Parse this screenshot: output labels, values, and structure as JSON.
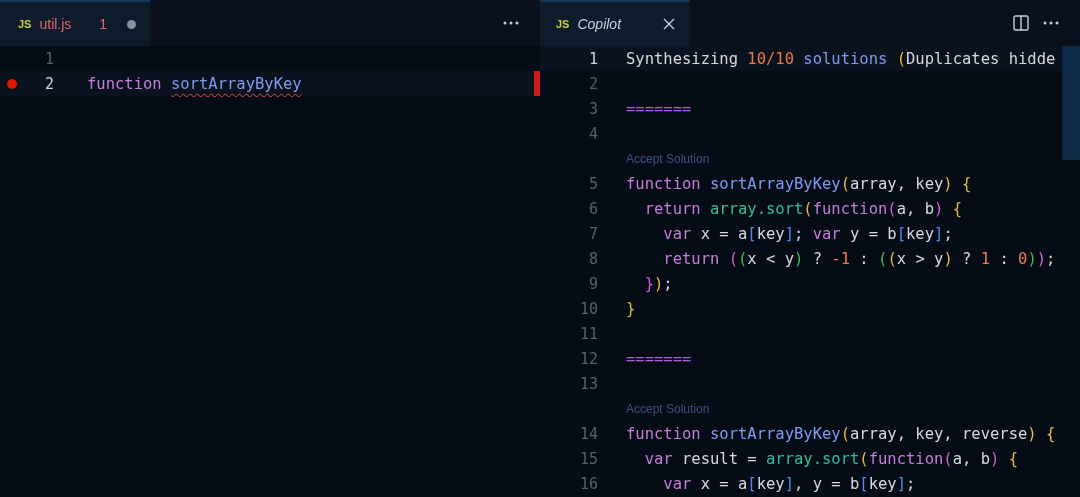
{
  "groups": [
    {
      "tab": {
        "icon": "JS",
        "label": "util.js",
        "badge": "1",
        "dirty": true,
        "error": true,
        "preview": false,
        "closable": false,
        "selected": true
      },
      "actions": [
        {
          "kind": "more"
        }
      ],
      "lines": [
        {
          "kind": "code",
          "number": "1",
          "current": false,
          "breakpoint": false
        },
        {
          "kind": "code",
          "number": "2",
          "current": true,
          "breakpoint": true,
          "error_mark": true,
          "tokens": [
            {
              "t": "function ",
              "kind": "keyword"
            },
            {
              "t": "sortArrayByKey",
              "kind": "function",
              "squiggle": true
            }
          ]
        }
      ]
    },
    {
      "tab": {
        "icon": "JS",
        "label": "Copilot",
        "dirty": false,
        "error": false,
        "preview": true,
        "closable": true,
        "selected": true
      },
      "actions": [
        {
          "kind": "split"
        },
        {
          "kind": "more"
        }
      ],
      "lines": [
        {
          "kind": "code",
          "number": "1",
          "current": true,
          "tokens": [
            {
              "t": "Synthesizing ",
              "kind": "plain"
            },
            {
              "t": "10/10",
              "kind": "number"
            },
            {
              "t": " solutions ",
              "kind": "function"
            },
            {
              "t": "(",
              "kind": "bracket1"
            },
            {
              "t": "Duplicates hidde",
              "kind": "plain"
            }
          ]
        },
        {
          "kind": "code",
          "number": "2",
          "current": false
        },
        {
          "kind": "code",
          "number": "3",
          "current": false,
          "tokens": [
            {
              "t": "=======",
              "kind": "separator"
            }
          ]
        },
        {
          "kind": "code",
          "number": "4",
          "current": false
        },
        {
          "kind": "codelens",
          "label": "Accept Solution"
        },
        {
          "kind": "code",
          "number": "5",
          "current": false,
          "tokens": [
            {
              "t": "function ",
              "kind": "keyword"
            },
            {
              "t": "sortArrayByKey",
              "kind": "function"
            },
            {
              "t": "(",
              "kind": "bracket1"
            },
            {
              "t": "array, key",
              "kind": "plain"
            },
            {
              "t": ") {",
              "kind": "bracket1"
            }
          ]
        },
        {
          "kind": "code",
          "number": "6",
          "current": false,
          "tokens": [
            {
              "t": "  return ",
              "kind": "keyword"
            },
            {
              "t": "array.sort",
              "kind": "variable"
            },
            {
              "t": "(",
              "kind": "bracket1"
            },
            {
              "t": "function",
              "kind": "keyword"
            },
            {
              "t": "(",
              "kind": "bracket2"
            },
            {
              "t": "a, b",
              "kind": "plain"
            },
            {
              "t": ")",
              "kind": "bracket2"
            },
            {
              "t": " {",
              "kind": "bracket1"
            }
          ]
        },
        {
          "kind": "code",
          "number": "7",
          "current": false,
          "tokens": [
            {
              "t": "    var ",
              "kind": "keyword"
            },
            {
              "t": "x = a",
              "kind": "plain"
            },
            {
              "t": "[",
              "kind": "bracket3"
            },
            {
              "t": "key",
              "kind": "plain"
            },
            {
              "t": "]",
              "kind": "bracket3"
            },
            {
              "t": "; ",
              "kind": "plain"
            },
            {
              "t": "var ",
              "kind": "keyword"
            },
            {
              "t": "y = b",
              "kind": "plain"
            },
            {
              "t": "[",
              "kind": "bracket3"
            },
            {
              "t": "key",
              "kind": "plain"
            },
            {
              "t": "]",
              "kind": "bracket3"
            },
            {
              "t": ";",
              "kind": "plain"
            }
          ]
        },
        {
          "kind": "code",
          "number": "8",
          "current": false,
          "tokens": [
            {
              "t": "    return ",
              "kind": "keyword"
            },
            {
              "t": "(",
              "kind": "bracket2"
            },
            {
              "t": "(",
              "kind": "bracket4"
            },
            {
              "t": "x < y",
              "kind": "plain"
            },
            {
              "t": ")",
              "kind": "bracket4"
            },
            {
              "t": " ? ",
              "kind": "plain"
            },
            {
              "t": "-1",
              "kind": "number"
            },
            {
              "t": " : ",
              "kind": "plain"
            },
            {
              "t": "(",
              "kind": "bracket4"
            },
            {
              "t": "(",
              "kind": "bracket1"
            },
            {
              "t": "x > y",
              "kind": "plain"
            },
            {
              "t": ")",
              "kind": "bracket1"
            },
            {
              "t": " ? ",
              "kind": "plain"
            },
            {
              "t": "1",
              "kind": "number"
            },
            {
              "t": " : ",
              "kind": "plain"
            },
            {
              "t": "0",
              "kind": "number"
            },
            {
              "t": ")",
              "kind": "bracket4"
            },
            {
              "t": ")",
              "kind": "bracket2"
            },
            {
              "t": ";",
              "kind": "plain"
            }
          ]
        },
        {
          "kind": "code",
          "number": "9",
          "current": false,
          "tokens": [
            {
              "t": "  }",
              "kind": "bracket2"
            },
            {
              "t": ")",
              "kind": "bracket1"
            },
            {
              "t": ";",
              "kind": "plain"
            }
          ]
        },
        {
          "kind": "code",
          "number": "10",
          "current": false,
          "tokens": [
            {
              "t": "}",
              "kind": "bracket1"
            }
          ]
        },
        {
          "kind": "code",
          "number": "11",
          "current": false
        },
        {
          "kind": "code",
          "number": "12",
          "current": false,
          "tokens": [
            {
              "t": "=======",
              "kind": "separator"
            }
          ]
        },
        {
          "kind": "code",
          "number": "13",
          "current": false
        },
        {
          "kind": "codelens",
          "label": "Accept Solution"
        },
        {
          "kind": "code",
          "number": "14",
          "current": false,
          "tokens": [
            {
              "t": "function ",
              "kind": "keyword"
            },
            {
              "t": "sortArrayByKey",
              "kind": "function"
            },
            {
              "t": "(",
              "kind": "bracket1"
            },
            {
              "t": "array, key, reverse",
              "kind": "plain"
            },
            {
              "t": ") {",
              "kind": "bracket1"
            }
          ]
        },
        {
          "kind": "code",
          "number": "15",
          "current": false,
          "tokens": [
            {
              "t": "  var ",
              "kind": "keyword"
            },
            {
              "t": "result = ",
              "kind": "plain"
            },
            {
              "t": "array.sort",
              "kind": "variable"
            },
            {
              "t": "(",
              "kind": "bracket1"
            },
            {
              "t": "function",
              "kind": "keyword"
            },
            {
              "t": "(",
              "kind": "bracket2"
            },
            {
              "t": "a, b",
              "kind": "plain"
            },
            {
              "t": ")",
              "kind": "bracket2"
            },
            {
              "t": " {",
              "kind": "bracket1"
            }
          ]
        },
        {
          "kind": "code",
          "number": "16",
          "current": false,
          "tokens": [
            {
              "t": "    var ",
              "kind": "keyword"
            },
            {
              "t": "x = a",
              "kind": "plain"
            },
            {
              "t": "[",
              "kind": "bracket3"
            },
            {
              "t": "key",
              "kind": "plain"
            },
            {
              "t": "]",
              "kind": "bracket3"
            },
            {
              "t": ", y = b",
              "kind": "plain"
            },
            {
              "t": "[",
              "kind": "bracket3"
            },
            {
              "t": "key",
              "kind": "plain"
            },
            {
              "t": "]",
              "kind": "bracket3"
            },
            {
              "t": ";",
              "kind": "plain"
            }
          ]
        }
      ]
    }
  ]
}
